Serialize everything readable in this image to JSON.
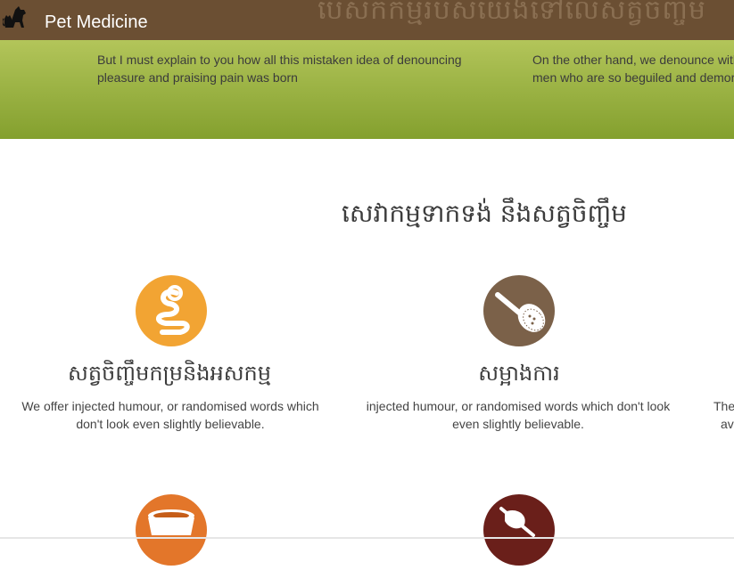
{
  "header": {
    "brand": "Pet Medicine",
    "background_text": "បេសកកម្មរបស់យើងទៅលើសត្វចិញ្ចឹម",
    "colors": {
      "bar": "#6b4f33",
      "hero_top": "#b3c55a",
      "hero_bottom": "#84a02e"
    }
  },
  "hero": {
    "left_text": "But I must explain to you how all this mistaken idea of denouncing pleasure and praising pain was born",
    "right_line1": "On the other hand, we denounce with",
    "right_line2": "men who are so beguiled and demora"
  },
  "services": {
    "title": "សេវាកម្មទាកទង់ នឹងសត្វចិញ្ចឹម",
    "cards": [
      {
        "icon": "snake-icon",
        "color": "#f2a433",
        "title": "សត្វចិញ្ចឹមកម្រនិងអសកម្ម",
        "desc": "We offer injected humour, or randomised words which don't look even slightly believable."
      },
      {
        "icon": "grooming-brush-icon",
        "color": "#7b6149",
        "title": "សម្អាងការ",
        "desc": "injected humour, or randomised words which don't look even slightly believable."
      },
      {
        "title_partial": "",
        "desc_line1": "The",
        "desc_line2": "av"
      },
      {
        "icon": "food-bowl-icon",
        "color": "#e3762a"
      },
      {
        "icon": "no-pet-icon",
        "color": "#6a1f1a"
      }
    ]
  }
}
